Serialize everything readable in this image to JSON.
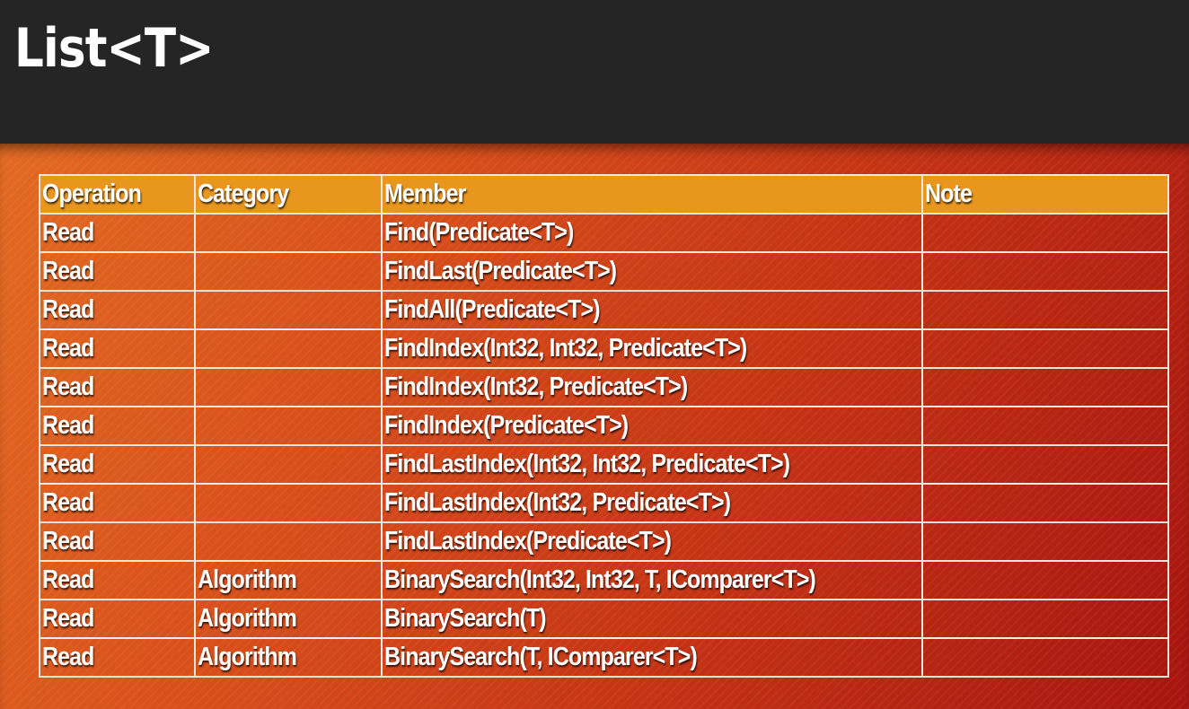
{
  "title": "List<T>",
  "table": {
    "headers": {
      "operation": "Operation",
      "category": "Category",
      "member": "Member",
      "note": "Note"
    },
    "rows": [
      {
        "operation": "Read",
        "category": "",
        "member": "Find(Predicate<T>)",
        "note": ""
      },
      {
        "operation": "Read",
        "category": "",
        "member": "FindLast(Predicate<T>)",
        "note": ""
      },
      {
        "operation": "Read",
        "category": "",
        "member": "FindAll(Predicate<T>)",
        "note": ""
      },
      {
        "operation": "Read",
        "category": "",
        "member": "FindIndex(Int32, Int32, Predicate<T>)",
        "note": ""
      },
      {
        "operation": "Read",
        "category": "",
        "member": "FindIndex(Int32, Predicate<T>)",
        "note": ""
      },
      {
        "operation": "Read",
        "category": "",
        "member": "FindIndex(Predicate<T>)",
        "note": ""
      },
      {
        "operation": "Read",
        "category": "",
        "member": "FindLastIndex(Int32, Int32, Predicate<T>)",
        "note": ""
      },
      {
        "operation": "Read",
        "category": "",
        "member": "FindLastIndex(Int32, Predicate<T>)",
        "note": ""
      },
      {
        "operation": "Read",
        "category": "",
        "member": "FindLastIndex(Predicate<T>)",
        "note": ""
      },
      {
        "operation": "Read",
        "category": "Algorithm",
        "member": "BinarySearch(Int32, Int32, T, IComparer<T>)",
        "note": ""
      },
      {
        "operation": "Read",
        "category": "Algorithm",
        "member": "BinarySearch(T)",
        "note": ""
      },
      {
        "operation": "Read",
        "category": "Algorithm",
        "member": "BinarySearch(T, IComparer<T>)",
        "note": ""
      }
    ]
  },
  "colors": {
    "title_bar": "#252525",
    "header_row": "#e8961e",
    "gradient_start": "#e26a22",
    "gradient_end": "#a71410",
    "grid_lines": "#f4e6da",
    "text": "#ffffff"
  }
}
